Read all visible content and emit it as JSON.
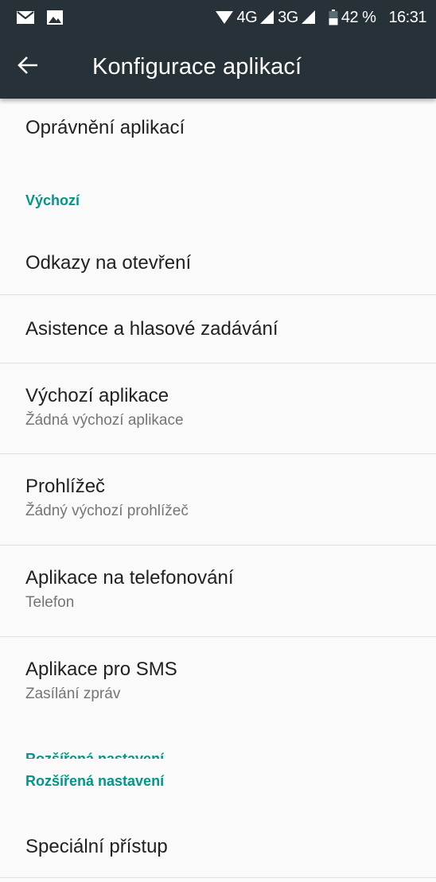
{
  "status_bar": {
    "network_4g": "4G",
    "network_3g": "3G",
    "battery": "42 %",
    "time": "16:31"
  },
  "toolbar": {
    "title": "Konfigurace aplikací"
  },
  "list": {
    "permissions": {
      "title": "Oprávnění aplikací"
    },
    "section_default": "Výchozí",
    "open_links": {
      "title": "Odkazy na otevření"
    },
    "assist_voice": {
      "title": "Asistence a hlasové zadávání"
    },
    "default_apps": {
      "title": "Výchozí aplikace",
      "subtitle": "Žádná výchozí aplikace"
    },
    "browser": {
      "title": "Prohlížeč",
      "subtitle": "Žádný výchozí prohlížeč"
    },
    "phone_app": {
      "title": "Aplikace na telefonování",
      "subtitle": "Telefon"
    },
    "sms_app": {
      "title": "Aplikace pro SMS",
      "subtitle": "Zasílání zpráv"
    },
    "section_advanced": "Rozšířená nastavení",
    "special_access": {
      "title": "Speciální přístup"
    }
  },
  "colors": {
    "toolbar": "#263238",
    "accent": "#009688",
    "background": "#fafafa",
    "divider": "#e0e0e0"
  },
  "icons": {
    "status_left": [
      "mail-icon",
      "image-icon"
    ],
    "status_right": [
      "wifi-icon",
      "signal-icon",
      "signal-icon",
      "battery-icon"
    ],
    "toolbar": [
      "back-arrow-icon"
    ]
  }
}
